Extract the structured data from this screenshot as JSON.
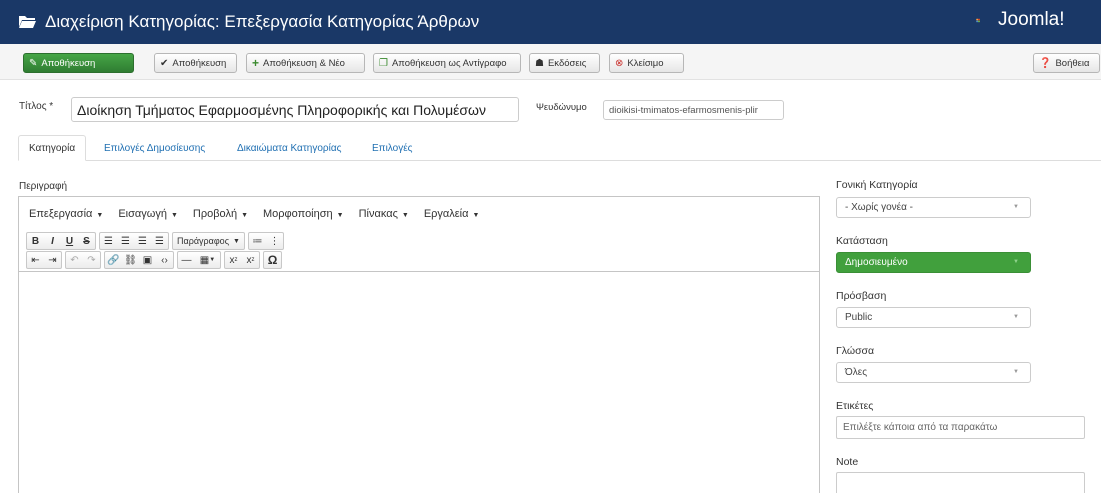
{
  "header": {
    "title": "Διαχείριση Κατηγορίας: Επεξεργασία Κατηγορίας Άρθρων",
    "logo_text": "Joomla!"
  },
  "toolbar": {
    "save": "Αποθήκευση",
    "save_close": "Αποθήκευση",
    "save_new": "Αποθήκευση & Νέο",
    "save_copy": "Αποθήκευση ως Αντίγραφο",
    "versions": "Εκδόσεις",
    "close": "Κλείσιμο",
    "help": "Βοήθεια"
  },
  "form": {
    "title_label": "Τίτλος *",
    "title_value": "Διοίκηση Τμήματος Εφαρμοσμένης Πληροφορικής και Πολυμέσων",
    "alias_label": "Ψευδώνυμο",
    "alias_value": "dioikisi-tmimatos-efarmosmenis-plir"
  },
  "tabs": [
    "Κατηγορία",
    "Επιλογές Δημοσίευσης",
    "Δικαιώματα Κατηγορίας",
    "Επιλογές"
  ],
  "editor": {
    "label": "Περιγραφή",
    "menus": [
      "Επεξεργασία",
      "Εισαγωγή",
      "Προβολή",
      "Μορφοποίηση",
      "Πίνακας",
      "Εργαλεία"
    ],
    "paragraph_dropdown": "Παράγραφος"
  },
  "sidebar": {
    "parent_label": "Γονική Κατηγορία",
    "parent_value": "- Χωρίς γονέα -",
    "status_label": "Κατάσταση",
    "status_value": "Δημοσιευμένο",
    "access_label": "Πρόσβαση",
    "access_value": "Public",
    "language_label": "Γλώσσα",
    "language_value": "Όλες",
    "tags_label": "Ετικέτες",
    "tags_placeholder": "Επιλέξτε κάποια από τα παρακάτω",
    "note_label": "Note"
  },
  "colors": {
    "header_bg": "#1a3867",
    "save_green": "#2f7d32",
    "published_green": "#41a03d",
    "link_blue": "#1f6fb2"
  }
}
